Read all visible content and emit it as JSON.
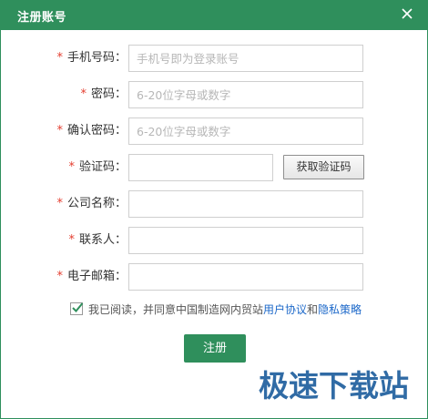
{
  "window": {
    "title": "注册账号"
  },
  "form": {
    "required_mark": "*",
    "separator": "：",
    "phone": {
      "label": "手机号码",
      "placeholder": "手机号即为登录账号",
      "value": ""
    },
    "password": {
      "label": "密码",
      "placeholder": "6-20位字母或数字",
      "value": ""
    },
    "confirm_password": {
      "label": "确认密码",
      "placeholder": "6-20位字母或数字",
      "value": ""
    },
    "verify_code": {
      "label": "验证码",
      "placeholder": "",
      "value": "",
      "button_label": "获取验证码"
    },
    "company": {
      "label": "公司名称",
      "placeholder": "",
      "value": ""
    },
    "contact": {
      "label": "联系人",
      "placeholder": "",
      "value": ""
    },
    "email": {
      "label": "电子邮箱",
      "placeholder": "",
      "value": ""
    }
  },
  "agreement": {
    "checked": true,
    "text": "我已阅读，并同意中国制造网内贸站",
    "link1": "用户协议",
    "and": "和",
    "link2": "隐私策略"
  },
  "submit_label": "注册",
  "watermark": "极速下载站",
  "colors": {
    "primary": "#2f8f5c",
    "required": "#e43d2f",
    "link": "#1c68c9",
    "watermark": "#1f5f9e"
  }
}
